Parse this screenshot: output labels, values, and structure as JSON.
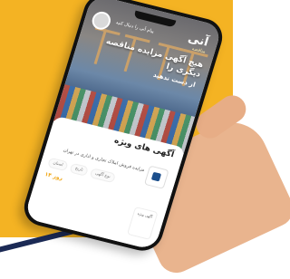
{
  "app": {
    "brand_name": "آنی",
    "brand_tagline": "مناقصه",
    "menu_text": "پیام آنی را دنبال کنید"
  },
  "hero": {
    "headline": "هیچ آگهی مزایده مناقصه دیگری را",
    "subtitle": "از دست ندهید"
  },
  "card": {
    "title": "آگهی های ویژه",
    "description": "مزایده فروش املاک تجاری و اداری در تهران",
    "chips": [
      "نوع آگهی",
      "تاریخ",
      "استان"
    ],
    "days_left": "۱۴ روز",
    "badge_text": "آگهی ویژه"
  },
  "colors": {
    "background": "#f4b323",
    "accent": "#f0a81a"
  }
}
